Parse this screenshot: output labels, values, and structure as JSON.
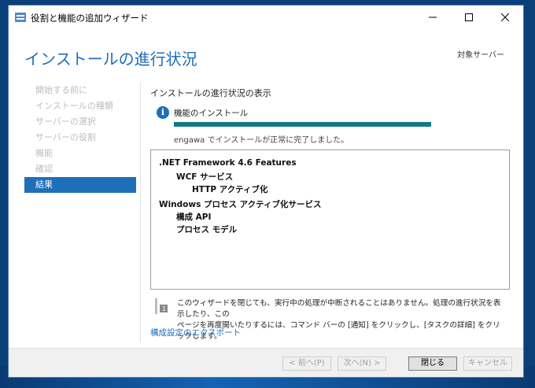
{
  "window": {
    "title": "役割と機能の追加ウィザード"
  },
  "header": {
    "page_title": "インストールの進行状況",
    "target_server": "対象サーバー"
  },
  "nav": {
    "items": [
      "開始する前に",
      "インストールの種類",
      "サーバーの選択",
      "サーバーの役割",
      "機能",
      "確認",
      "結果"
    ],
    "active_index": 6
  },
  "content": {
    "heading": "インストールの進行状況の表示",
    "feature_label": "機能のインストール",
    "progress_fraction": 1.0,
    "status": "engawa でインストールが正常に完了しました。"
  },
  "results": [
    {
      "text": ".NET Framework 4.6 Features",
      "level": 0
    },
    {
      "text": "WCF サービス",
      "level": 1
    },
    {
      "text": "HTTP アクティブ化",
      "level": 2
    },
    {
      "text": "Windows プロセス アクティブ化サービス",
      "level": 0
    },
    {
      "text": "構成 API",
      "level": 1
    },
    {
      "text": "プロセス モデル",
      "level": 1
    }
  ],
  "note": {
    "line1": "このウィザードを閉じても、実行中の処理が中断されることはありません。処理の進行状況を表示したり、この",
    "line2": "ページを再度開いたりするには、コマンド バーの [通知] をクリックし、[タスクの詳細] をクリックします。"
  },
  "export_link": "構成設定のエクスポート",
  "footer": {
    "prev": "< 前へ(P)",
    "next": "次へ(N) >",
    "close": "閉じる",
    "cancel": "キャンセル"
  },
  "colors": {
    "accent": "#1e6fb9",
    "progress": "#14788a"
  }
}
